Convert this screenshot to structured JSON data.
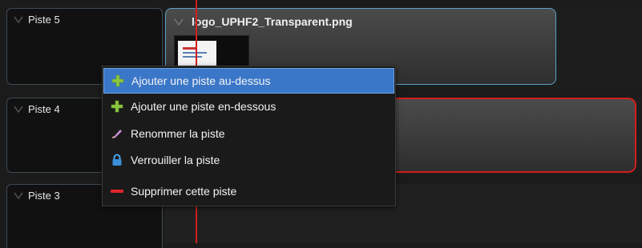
{
  "tracks": [
    {
      "label": "Piste 5"
    },
    {
      "label": "Piste 4"
    },
    {
      "label": "Piste 3"
    }
  ],
  "clip": {
    "title": "logo_UPHF2_Transparent.png"
  },
  "context_menu": {
    "items": [
      {
        "label": "Ajouter une piste au-dessus",
        "icon": "plus-icon",
        "selected": true
      },
      {
        "label": "Ajouter une piste en-dessous",
        "icon": "plus-icon",
        "selected": false
      },
      {
        "label": "Renommer la piste",
        "icon": "pencil-icon",
        "selected": false
      },
      {
        "label": "Verrouiller la piste",
        "icon": "lock-icon",
        "selected": false
      },
      {
        "label": "Supprimer cette piste",
        "icon": "minus-icon",
        "selected": false
      }
    ]
  },
  "colors": {
    "accent_blue": "#3a77c8",
    "playhead_red": "#d41d1d",
    "plus_green": "#8cc63f",
    "minus_red": "#e0242a"
  }
}
